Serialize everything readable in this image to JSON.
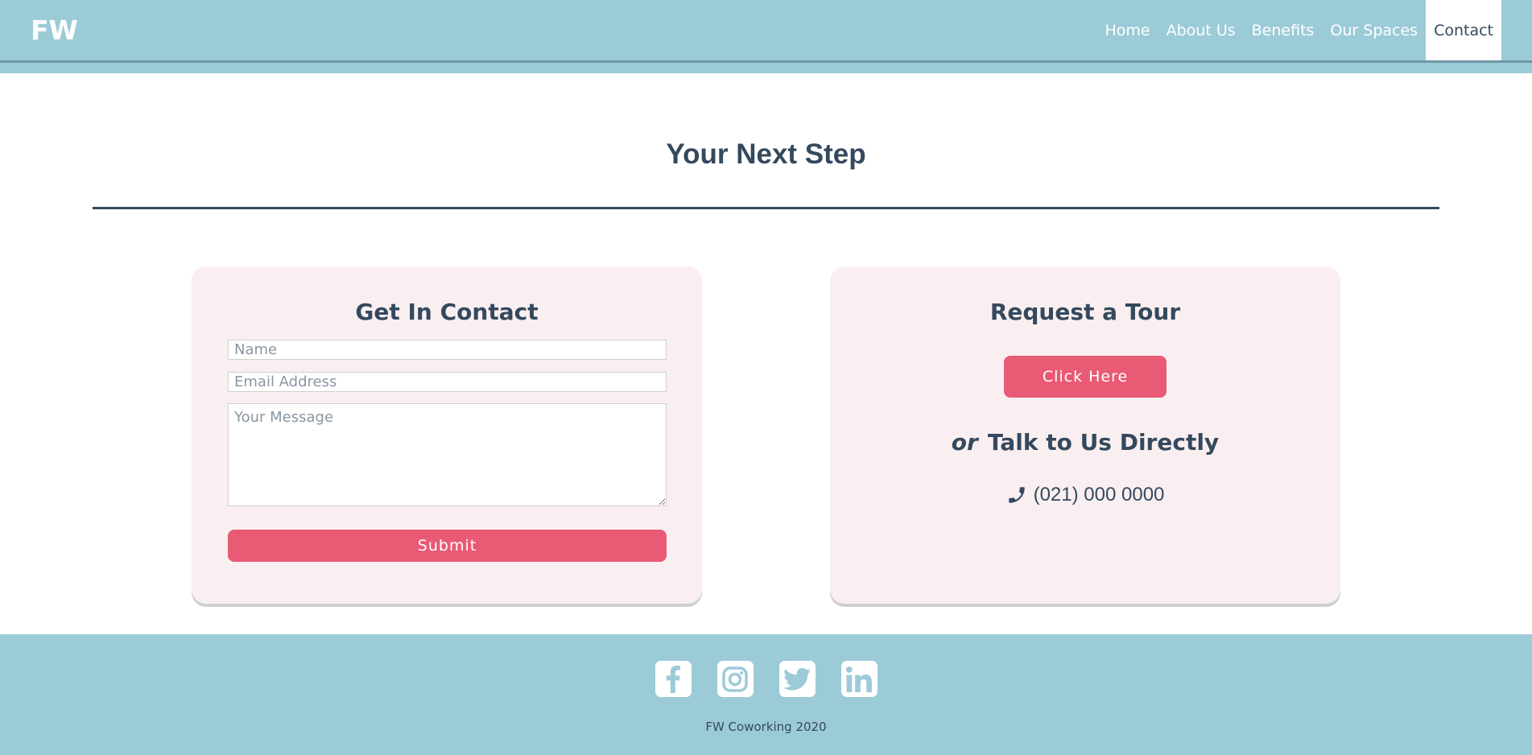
{
  "header": {
    "logo": "FW",
    "nav": [
      {
        "label": "Home"
      },
      {
        "label": "About Us"
      },
      {
        "label": "Benefits"
      },
      {
        "label": "Our Spaces"
      },
      {
        "label": "Contact",
        "active": true
      }
    ]
  },
  "main": {
    "title": "Your Next Step",
    "contact_card": {
      "title": "Get In Contact",
      "name_placeholder": "Name",
      "email_placeholder": "Email Address",
      "message_placeholder": "Your Message",
      "submit_label": "Submit"
    },
    "tour_card": {
      "title": "Request a Tour",
      "button_label": "Click Here",
      "or_text": "or",
      "talk_text": "Talk to Us Directly",
      "phone": "(021) 000 0000"
    }
  },
  "footer": {
    "social": [
      "facebook-icon",
      "instagram-icon",
      "twitter-icon",
      "linkedin-icon"
    ],
    "copyright": "FW Coworking 2020"
  },
  "colors": {
    "header_bg": "#9ccbd8",
    "text_dark": "#34495e",
    "accent": "#e95a75",
    "card_bg": "#faeff0"
  }
}
